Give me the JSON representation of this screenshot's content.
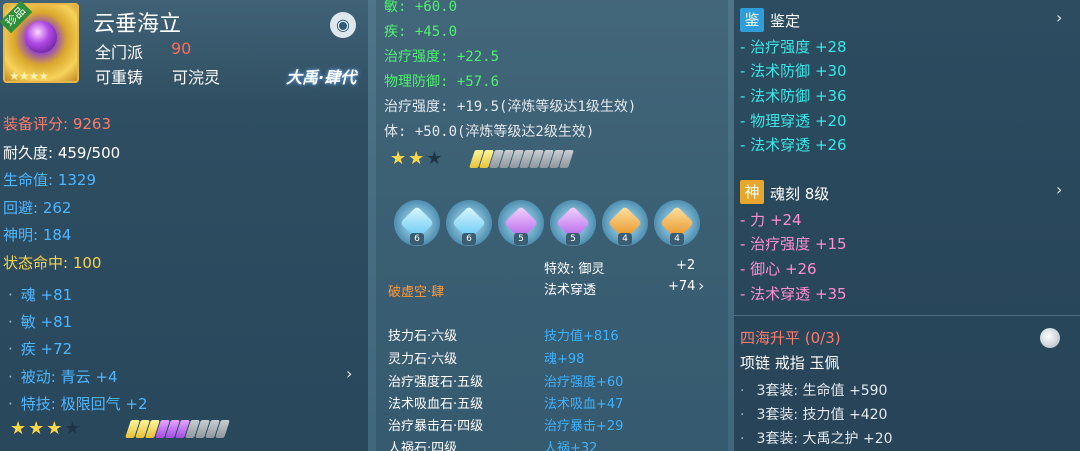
{
  "panel1": {
    "badge": "珍品",
    "title": "云垂海立",
    "school": "全门派",
    "level": "90",
    "recast": "可重铸",
    "refine": "可浣灵",
    "era": "大禹·肆代",
    "stats": [
      {
        "label": "装备评分:",
        "value": "9263",
        "color": "red"
      },
      {
        "label": "耐久度:",
        "value": "459/500",
        "color": "white"
      },
      {
        "label": "生命值:",
        "value": "1329",
        "color": "blue"
      },
      {
        "label": "回避:",
        "value": "262",
        "color": "blue"
      },
      {
        "label": "神明:",
        "value": "184",
        "color": "blue"
      },
      {
        "label": "状态命中:",
        "value": "100",
        "color": "yellow"
      }
    ],
    "bonuses": [
      "魂 +81",
      "敏 +81",
      "疾 +72",
      "被动: 青云 +4",
      "特技: 极限回气 +2"
    ],
    "stars_on": 3,
    "stars_total": 4,
    "bars": {
      "gold": 3,
      "purple": 3,
      "empty": 4
    }
  },
  "panel2": {
    "lines_green": [
      "敏: +60.0",
      "疾: +45.0",
      "治疗强度: +22.5",
      "物理防御: +57.6"
    ],
    "lines_white": [
      "治疗强度: +19.5(淬炼等级达1级生效)",
      "体: +50.0(淬炼等级达2级生效)"
    ],
    "stars_on": 2,
    "stars_total": 3,
    "bars": {
      "gold": 2,
      "purple": 0,
      "empty": 8
    },
    "gem_levels": [
      "6",
      "6",
      "5",
      "5",
      "4",
      "4"
    ],
    "effect_label": "特效: 御灵",
    "effect_value": "+2",
    "penetrate_label": "法术穿透",
    "penetrate_value": "+74",
    "set_name": "破虚空·肆",
    "stones": [
      {
        "name": "技力石·六级",
        "effect": "技力值+816"
      },
      {
        "name": "灵力石·六级",
        "effect": "魂+98"
      },
      {
        "name": "治疗强度石·五级",
        "effect": "治疗强度+60"
      },
      {
        "name": "法术吸血石·五级",
        "effect": "法术吸血+47"
      },
      {
        "name": "治疗暴击石·四级",
        "effect": "治疗暴击+29"
      },
      {
        "name": "人祸石·四级",
        "effect": "人祸+32"
      }
    ]
  },
  "panel3": {
    "appraise_tag": "鉴",
    "appraise_title": "鉴定",
    "appraise_lines": [
      "- 治疗强度 +28",
      "- 法术防御 +30",
      "- 法术防御 +36",
      "- 物理穿透 +20",
      "- 法术穿透 +26"
    ],
    "soul_tag": "神",
    "soul_title": "魂刻  8级",
    "soul_lines": [
      "- 力 +24",
      "- 治疗强度 +15",
      "- 御心 +26",
      "- 法术穿透 +35"
    ],
    "set_title": "四海升平 (0/3)",
    "set_pieces": "项链  戒指  玉佩",
    "set_bonuses": [
      "3套装: 生命值 +590",
      "3套装: 技力值 +420",
      "3套装: 大禹之护 +20"
    ]
  }
}
